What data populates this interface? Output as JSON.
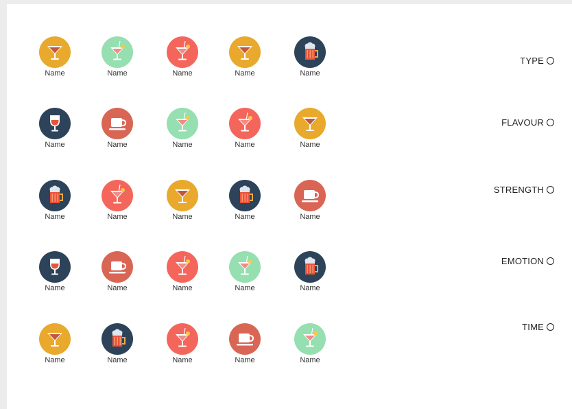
{
  "colors": {
    "yellow": "#e8a92d",
    "green": "#95dfb0",
    "red": "#f4665b",
    "navy": "#2d4359",
    "coral": "#d96655"
  },
  "grid": [
    [
      {
        "label": "Name",
        "color": "yellow",
        "icon": "martini-icon"
      },
      {
        "label": "Name",
        "color": "green",
        "icon": "cocktail-icon"
      },
      {
        "label": "Name",
        "color": "red",
        "icon": "cocktail-icon"
      },
      {
        "label": "Name",
        "color": "yellow",
        "icon": "martini-icon"
      },
      {
        "label": "Name",
        "color": "navy",
        "icon": "beer-mug-icon"
      }
    ],
    [
      {
        "label": "Name",
        "color": "navy",
        "icon": "wine-glass-icon"
      },
      {
        "label": "Name",
        "color": "coral",
        "icon": "coffee-cup-icon"
      },
      {
        "label": "Name",
        "color": "green",
        "icon": "cocktail-icon"
      },
      {
        "label": "Name",
        "color": "red",
        "icon": "cocktail-icon"
      },
      {
        "label": "Name",
        "color": "yellow",
        "icon": "martini-icon"
      }
    ],
    [
      {
        "label": "Name",
        "color": "navy",
        "icon": "beer-mug-icon"
      },
      {
        "label": "Name",
        "color": "red",
        "icon": "cocktail-icon"
      },
      {
        "label": "Name",
        "color": "yellow",
        "icon": "martini-icon"
      },
      {
        "label": "Name",
        "color": "navy",
        "icon": "beer-mug-icon"
      },
      {
        "label": "Name",
        "color": "coral",
        "icon": "coffee-cup-icon"
      }
    ],
    [
      {
        "label": "Name",
        "color": "navy",
        "icon": "wine-glass-icon"
      },
      {
        "label": "Name",
        "color": "coral",
        "icon": "coffee-cup-icon"
      },
      {
        "label": "Name",
        "color": "red",
        "icon": "cocktail-icon"
      },
      {
        "label": "Name",
        "color": "green",
        "icon": "cocktail-icon"
      },
      {
        "label": "Name",
        "color": "navy",
        "icon": "beer-mug-icon"
      }
    ],
    [
      {
        "label": "Name",
        "color": "yellow",
        "icon": "martini-icon"
      },
      {
        "label": "Name",
        "color": "navy",
        "icon": "beer-mug-icon"
      },
      {
        "label": "Name",
        "color": "red",
        "icon": "cocktail-icon"
      },
      {
        "label": "Name",
        "color": "coral",
        "icon": "coffee-cup-icon"
      },
      {
        "label": "Name",
        "color": "green",
        "icon": "cocktail-icon"
      }
    ]
  ],
  "filters": [
    {
      "label": "TYPE",
      "selected": false
    },
    {
      "label": "FLAVOUR",
      "selected": false
    },
    {
      "label": "STRENGTH",
      "selected": false
    },
    {
      "label": "EMOTION",
      "selected": false
    },
    {
      "label": "TIME",
      "selected": false
    }
  ]
}
